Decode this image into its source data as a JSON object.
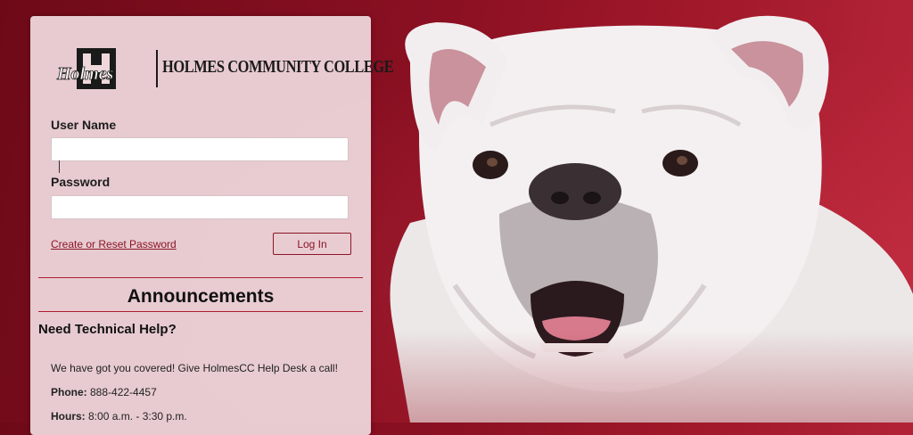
{
  "logo": {
    "badge_text": "Holmes",
    "college_name": "HOLMES COMMUNITY COLLEGE"
  },
  "login": {
    "username_label": "User Name",
    "username_value": "",
    "password_label": "Password",
    "password_value": "",
    "reset_link": "Create or Reset Password",
    "login_button": "Log In"
  },
  "announcements": {
    "title": "Announcements",
    "help_title": "Need Technical Help?",
    "message": "We have got you covered! Give HolmesCC Help Desk a call!",
    "phone_label": "Phone:",
    "phone_value": " 888-422-4457",
    "hours_label": "Hours:",
    "hours_value": " 8:00 a.m. - 3:30 p.m."
  },
  "colors": {
    "brand_maroon": "#8c1528",
    "panel_bg": "#eed8dc",
    "rule_red": "#b01c32"
  },
  "icons": {
    "hero_image": "bulldog-mascot"
  }
}
